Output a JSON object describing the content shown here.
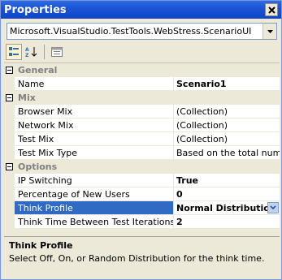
{
  "window": {
    "title": "Properties"
  },
  "object_selector": {
    "value": "Microsoft.VisualStudio.TestTools.WebStress.ScenarioUI"
  },
  "toolbar": {
    "buttons": [
      {
        "name": "categorized-view",
        "pressed": true
      },
      {
        "name": "alphabetical-sort",
        "pressed": false
      },
      {
        "name": "property-pages",
        "pressed": false
      }
    ]
  },
  "grid": {
    "categories": [
      {
        "name": "General",
        "properties": [
          {
            "name": "Name",
            "value": "Scenario1",
            "bold": true
          }
        ]
      },
      {
        "name": "Mix",
        "properties": [
          {
            "name": "Browser Mix",
            "value": "(Collection)",
            "bold": false
          },
          {
            "name": "Network Mix",
            "value": "(Collection)",
            "bold": false
          },
          {
            "name": "Test Mix",
            "value": "(Collection)",
            "bold": false
          },
          {
            "name": "Test Mix Type",
            "value": "Based on the total number",
            "bold": false
          }
        ]
      },
      {
        "name": "Options",
        "properties": [
          {
            "name": "IP Switching",
            "value": "True",
            "bold": true
          },
          {
            "name": "Percentage of New Users",
            "value": "0",
            "bold": true
          },
          {
            "name": "Think Profile",
            "value": "Normal Distribution",
            "bold": true,
            "selected": true
          },
          {
            "name": "Think Time Between Test Iterations",
            "value": "2",
            "bold": true
          }
        ]
      }
    ]
  },
  "help": {
    "title": "Think Profile",
    "description": "Select Off, On, or Random Distribution for the think time."
  },
  "colors": {
    "title_bar": "#0F45C8",
    "selection": "#316AC5",
    "category_bg": "#ECE9D8"
  }
}
